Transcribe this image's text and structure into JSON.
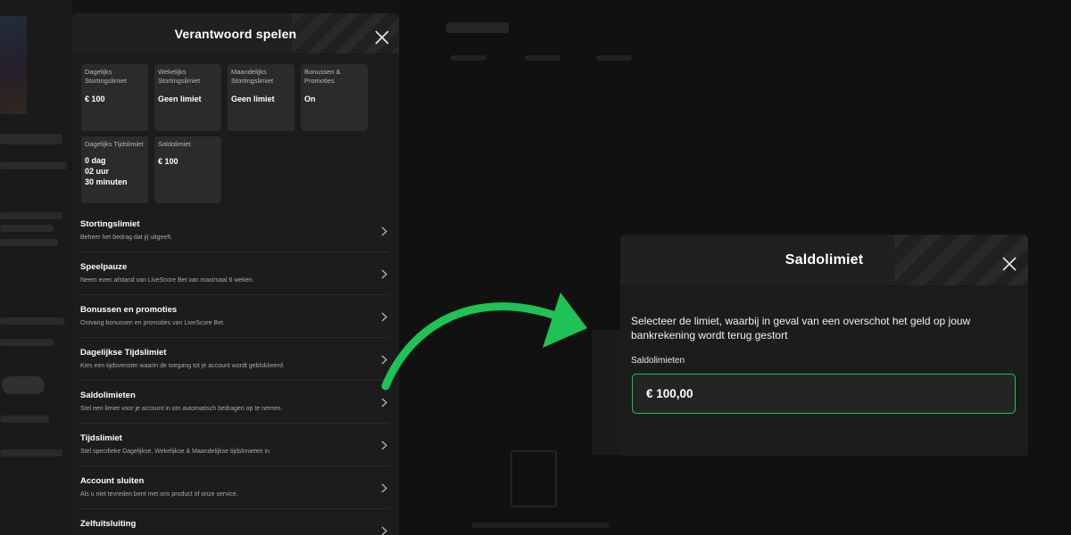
{
  "colors": {
    "accent": "#1fc255",
    "panel": "#1c1c1c",
    "card": "#2b2b2b"
  },
  "left_panel": {
    "title": "Verantwoord spelen",
    "close_icon": "close-icon",
    "summary_cards": [
      {
        "label": "Dagelijks Stortingslimiet",
        "value": "€ 100"
      },
      {
        "label": "Wekelijks Stortingslimiet",
        "value": "Geen limiet"
      },
      {
        "label": "Maandelijks Stortingslimiet",
        "value": "Geen limiet"
      },
      {
        "label": "Bonussen & Promoties",
        "value": "On"
      },
      {
        "label": "Dagelijks Tijdslimiet",
        "value": "0 dag\n02 uur\n30 minuten"
      },
      {
        "label": "Saldolimiet",
        "value": "€ 100"
      }
    ],
    "menu": [
      {
        "title": "Stortingslimiet",
        "desc": "Beheer het bedrag dat jij uitgeeft."
      },
      {
        "title": "Speelpauze",
        "desc": "Neem even afstand van LiveScore Bet van maximaal 6 weken."
      },
      {
        "title": "Bonussen en promoties",
        "desc": "Ontvang bonussen en promoties van LiveScore Bet."
      },
      {
        "title": "Dagelijkse Tijdslimiet",
        "desc": "Kies een tijdsvenster waarin de toegang tot je account wordt geblokkeerd."
      },
      {
        "title": "Saldolimieten",
        "desc": "Stel een limiet voor je account in om automatisch bedragen op te nemen."
      },
      {
        "title": "Tijdslimiet",
        "desc": "Stel specifieke Dagelijkse, Wekelijkse & Maandelijkse tijdslimieten in."
      },
      {
        "title": "Account sluiten",
        "desc": "Als u niet tevreden bent met ons product of onze service."
      },
      {
        "title": "Zelfuitsluiting",
        "desc": ""
      }
    ]
  },
  "right_panel": {
    "title": "Saldolimiet",
    "instruction": "Selecteer de limiet, waarbij in geval van een overschot het geld op jouw bankrekening wordt terug gestort",
    "field_label": "Saldolimieten",
    "field_value": "€ 100,00"
  }
}
